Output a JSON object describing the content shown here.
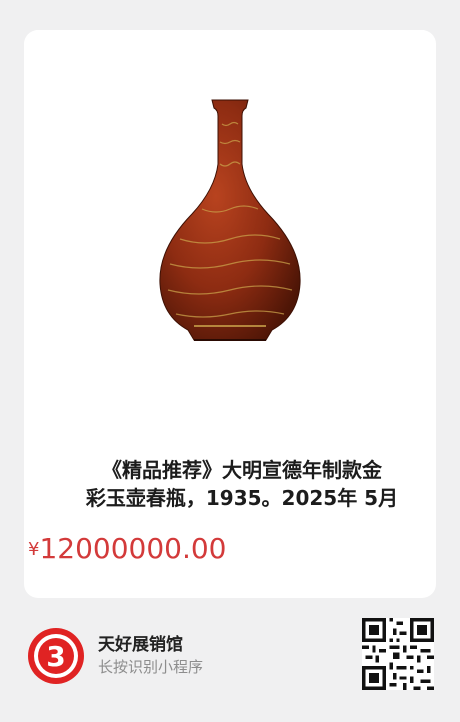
{
  "product": {
    "title_line1": "《精品推荐》大明宣德年制款金",
    "title_line2": "彩玉壶春瓶，1935。2025年 5月",
    "price_symbol": "¥",
    "price_value": "12000000.00"
  },
  "mini_program": {
    "name": "天好展销馆",
    "hint": "长按识别小程序",
    "logo_char": "3"
  },
  "colors": {
    "price": "#d33a3a",
    "logo_red": "#e02323",
    "background": "#f0f0f1"
  }
}
